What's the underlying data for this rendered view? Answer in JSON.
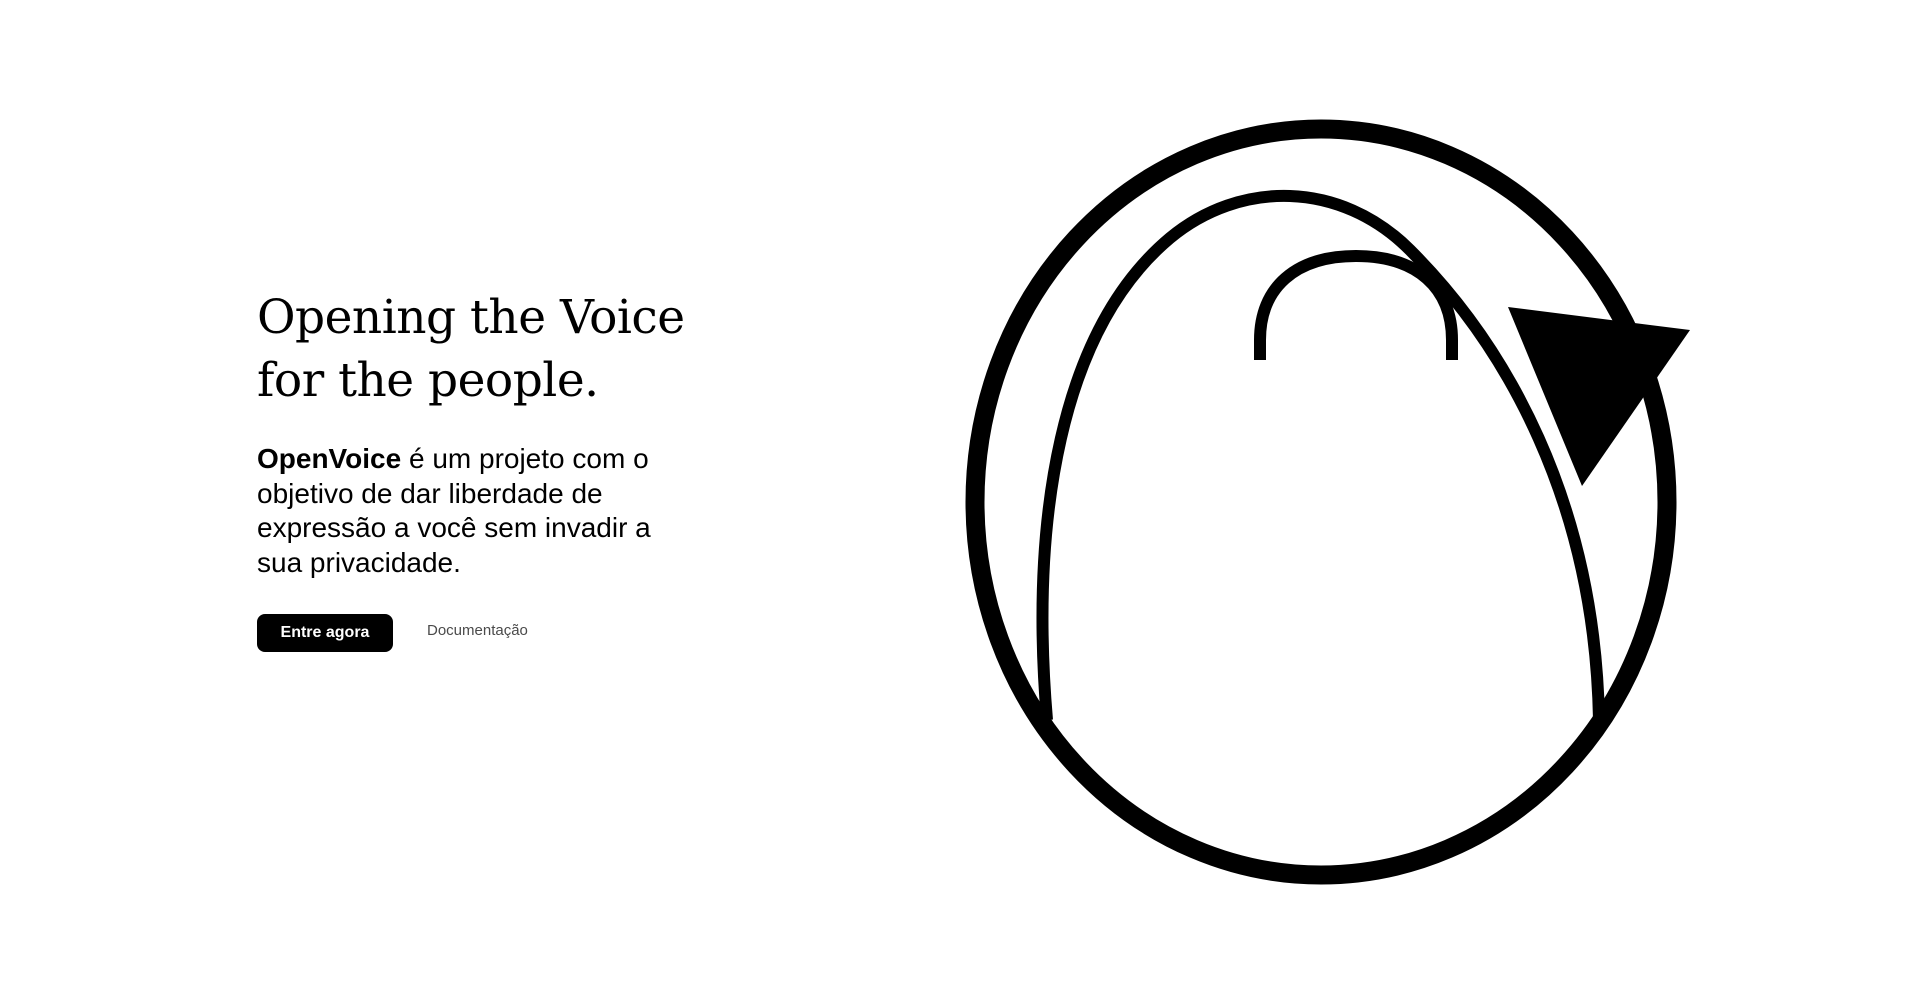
{
  "hero": {
    "headline_line1": "Opening the Voice",
    "headline_line2": "for the people.",
    "brand_name": "OpenVoice",
    "description": " é um projeto com o objetivo de dar liberdade de expressão a você sem invadir a sua privacidade.",
    "primary_button_label": "Entre agora",
    "docs_link_label": "Documentação"
  },
  "illustration": {
    "name": "openvoice-logo",
    "stroke_color": "#000000",
    "background_color": "#ffffff"
  }
}
